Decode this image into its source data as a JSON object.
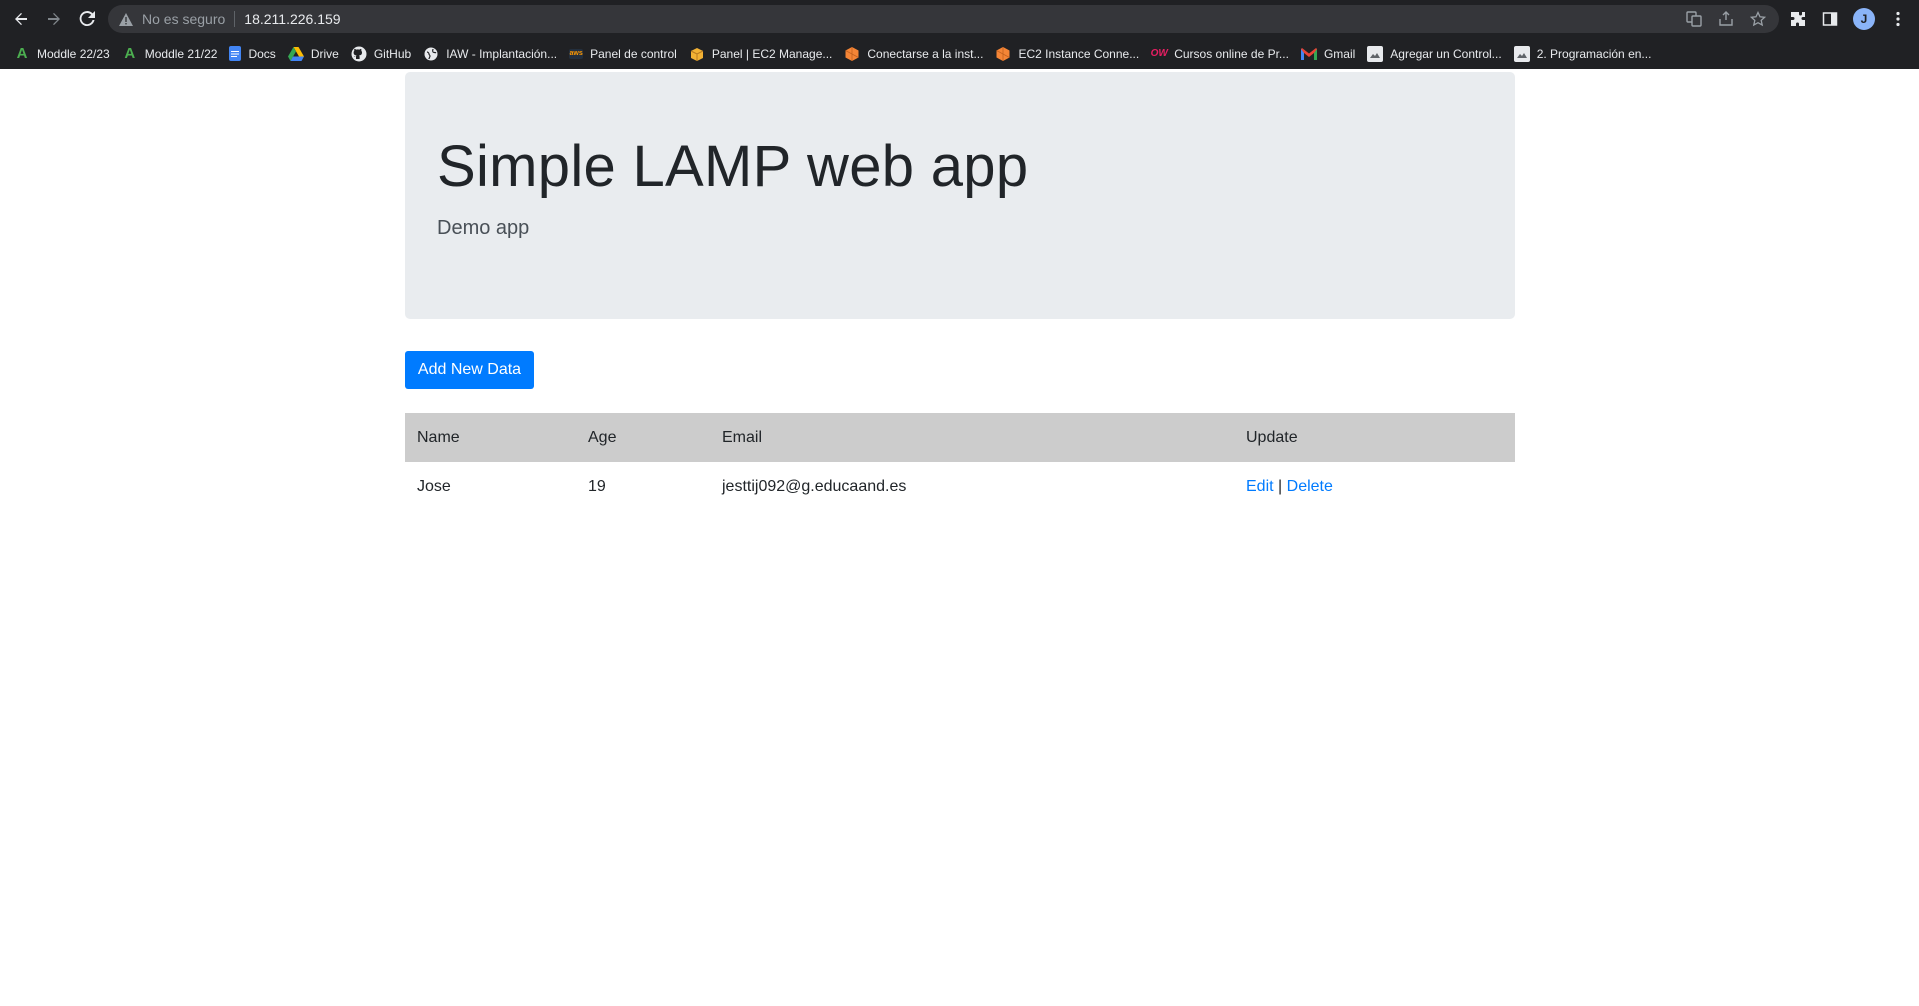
{
  "browser": {
    "security_label": "No es seguro",
    "url": "18.211.226.159",
    "avatar_initial": "J",
    "bookmarks": [
      {
        "label": "Moddle 22/23",
        "icon": "moodle-icon"
      },
      {
        "label": "Moddle 21/22",
        "icon": "moodle-icon"
      },
      {
        "label": "Docs",
        "icon": "docs-icon"
      },
      {
        "label": "Drive",
        "icon": "drive-icon"
      },
      {
        "label": "GitHub",
        "icon": "github-icon"
      },
      {
        "label": "IAW - Implantación...",
        "icon": "globe-icon"
      },
      {
        "label": "Panel de control",
        "icon": "aws-icon"
      },
      {
        "label": "Panel | EC2 Manage...",
        "icon": "box-icon"
      },
      {
        "label": "Conectarse a la inst...",
        "icon": "ec2-icon"
      },
      {
        "label": "EC2 Instance Conne...",
        "icon": "ec2-icon"
      },
      {
        "label": "Cursos online de Pr...",
        "icon": "ow-icon"
      },
      {
        "label": "Gmail",
        "icon": "gmail-icon"
      },
      {
        "label": "Agregar un Control...",
        "icon": "page-icon"
      },
      {
        "label": "2. Programación en...",
        "icon": "page-icon"
      }
    ],
    "colors": {
      "chrome_bg": "#202124",
      "omnibox_bg": "#35363a"
    }
  },
  "page": {
    "title": "Simple LAMP web app",
    "subtitle": "Demo app",
    "add_button_label": "Add New Data",
    "table": {
      "headers": [
        "Name",
        "Age",
        "Email",
        "Update"
      ],
      "rows": [
        {
          "name": "Jose",
          "age": "19",
          "email": "jesttij092@g.educaand.es",
          "edit_label": "Edit",
          "separator": "|",
          "delete_label": "Delete"
        }
      ]
    },
    "colors": {
      "primary": "#007bff",
      "jumbotron_bg": "#e9ecef",
      "table_header_bg": "#cccccc"
    }
  }
}
